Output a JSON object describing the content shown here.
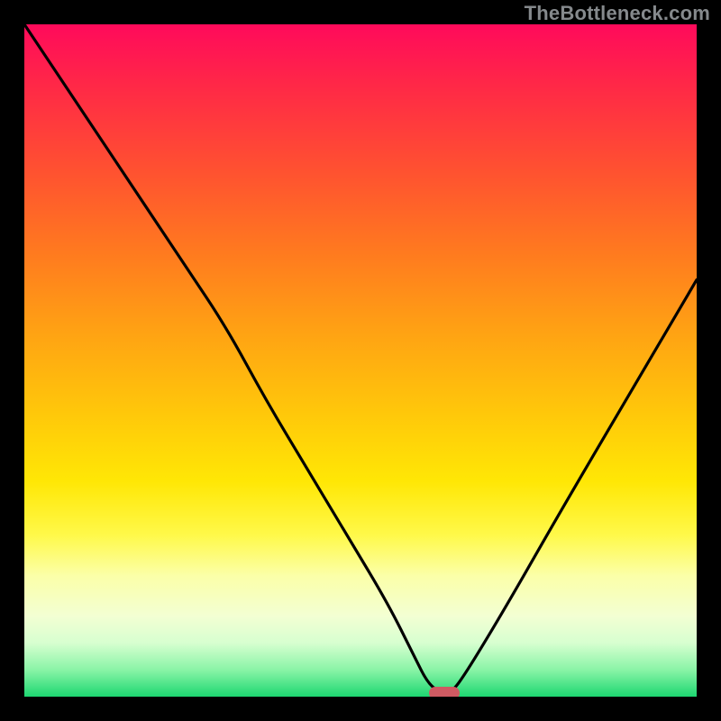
{
  "watermark": "TheBottleneck.com",
  "colors": {
    "frame": "#000000",
    "curve": "#000000",
    "marker": "#cf5a62",
    "watermark_text": "#85898c"
  },
  "chart_data": {
    "type": "line",
    "title": "",
    "xlabel": "",
    "ylabel": "",
    "xlim": [
      0,
      100
    ],
    "ylim": [
      0,
      100
    ],
    "grid": false,
    "legend": false,
    "series": [
      {
        "name": "bottleneck-curve",
        "x": [
          0,
          8,
          16,
          24,
          30,
          36,
          42,
          48,
          54,
          58,
          60,
          62,
          63.5,
          66,
          72,
          80,
          90,
          100
        ],
        "y": [
          100,
          88,
          76,
          64,
          55,
          44,
          34,
          24,
          14,
          6,
          2,
          0.5,
          0.5,
          4,
          14,
          28,
          45,
          62
        ]
      }
    ],
    "marker": {
      "x": 62.5,
      "y": 0.5
    }
  }
}
